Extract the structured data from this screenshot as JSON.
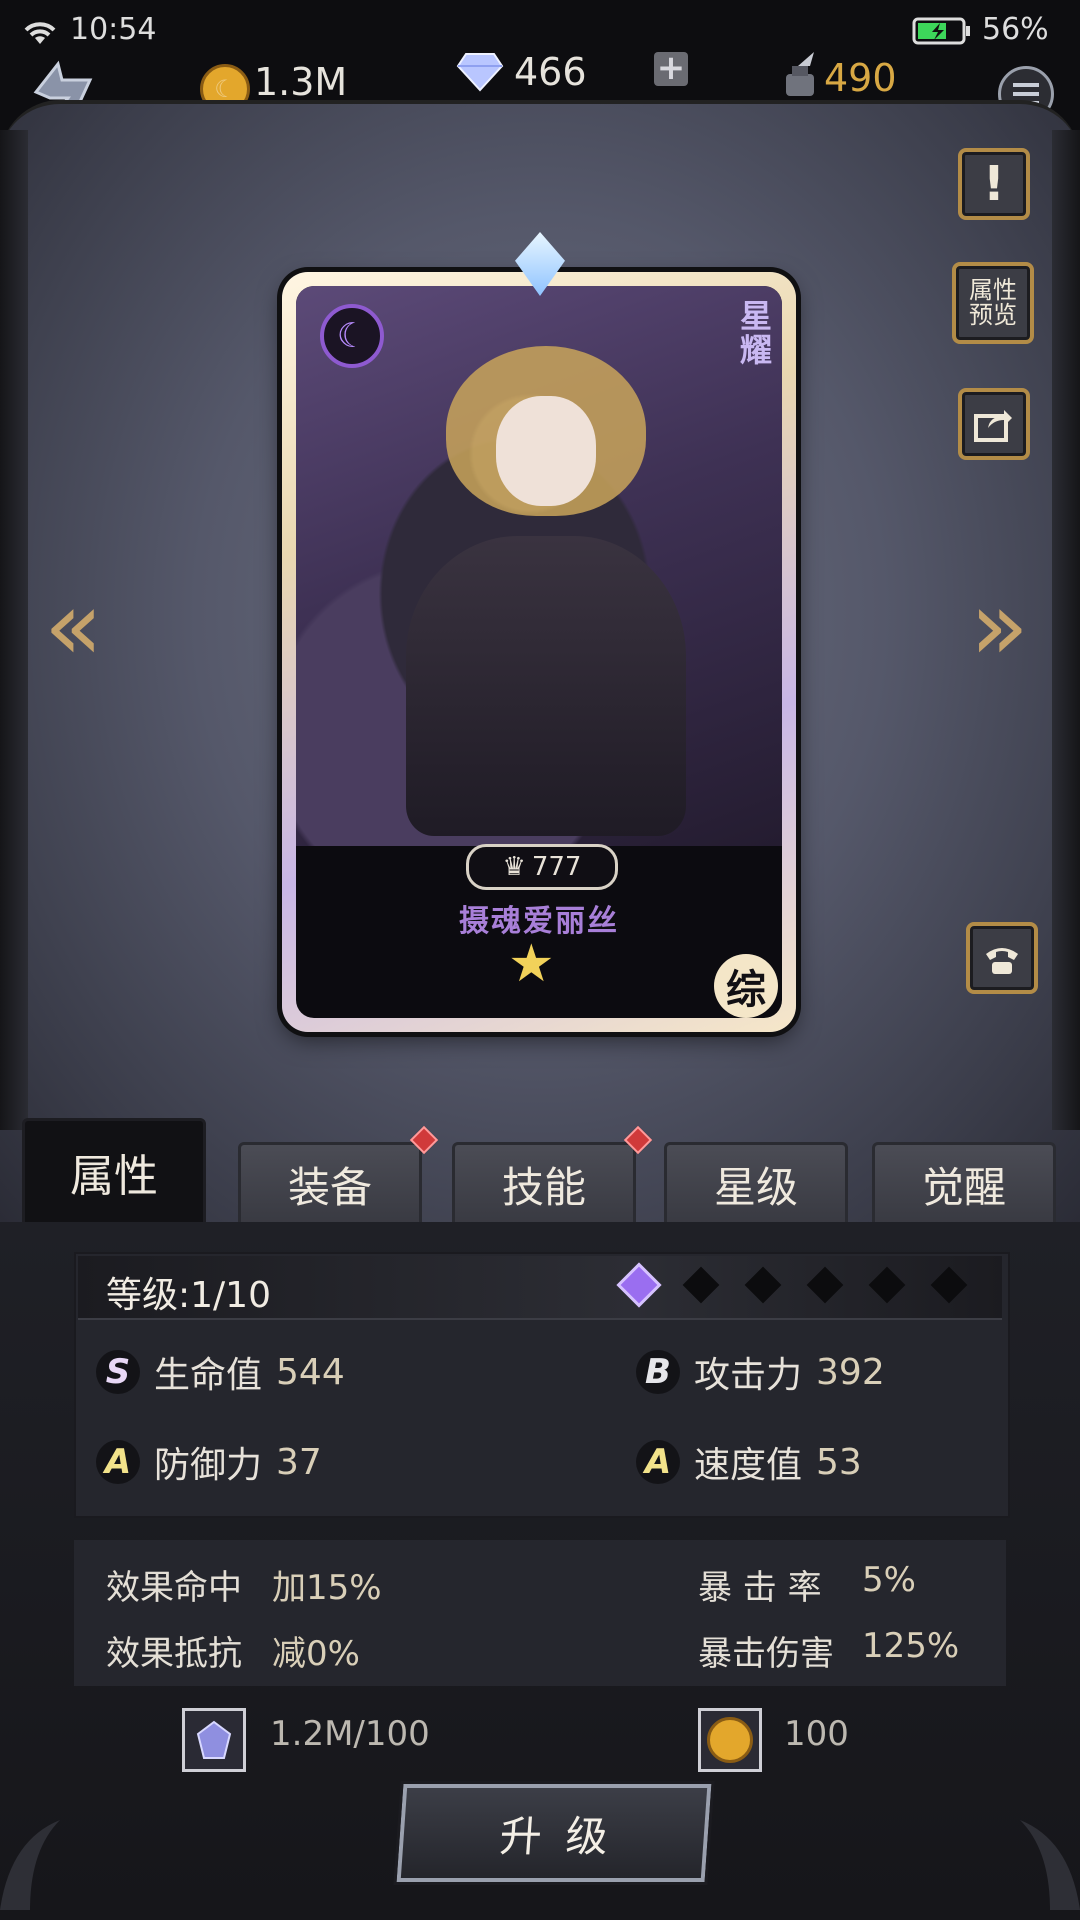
{
  "status": {
    "time": "10:54",
    "battery_pct": "56%"
  },
  "resources": {
    "gold": "1.3M",
    "diamonds": "466",
    "ink": "490"
  },
  "card": {
    "tag": "星耀",
    "power": "777",
    "name": "摄魂爱丽丝",
    "stars": 1,
    "star_glyph": "★",
    "class_label": "综",
    "crown_glyph": "♛"
  },
  "side_buttons": {
    "attr_preview": "属性预览"
  },
  "tabs": [
    {
      "label": "属性",
      "active": true,
      "dot": false
    },
    {
      "label": "装备",
      "active": false,
      "dot": true
    },
    {
      "label": "技能",
      "active": false,
      "dot": true
    },
    {
      "label": "星级",
      "active": false,
      "dot": false
    },
    {
      "label": "觉醒",
      "active": false,
      "dot": false
    }
  ],
  "level": {
    "text": "等级:1/10",
    "filled": 1,
    "total": 6
  },
  "stats": [
    {
      "grade": "S",
      "label": "生命值",
      "value": "544"
    },
    {
      "grade": "B",
      "label": "攻击力",
      "value": "392"
    },
    {
      "grade": "A",
      "label": "防御力",
      "value": "37"
    },
    {
      "grade": "A",
      "label": "速度值",
      "value": "53"
    }
  ],
  "sub_stats": {
    "effect_hit_label": "效果命中",
    "effect_hit_value": "加15%",
    "crit_rate_label": "暴 击 率",
    "crit_rate_value": "5%",
    "effect_res_label": "效果抵抗",
    "effect_res_value": "减0%",
    "crit_dmg_label": "暴击伤害",
    "crit_dmg_value": "125%"
  },
  "cost": {
    "crystal": "1.2M/100",
    "gold": "100"
  },
  "upgrade_label": "升级",
  "colors": {
    "accent_gold": "#c5a26a",
    "ink_gold": "#d8a844",
    "purple_name": "#a87fd8"
  }
}
